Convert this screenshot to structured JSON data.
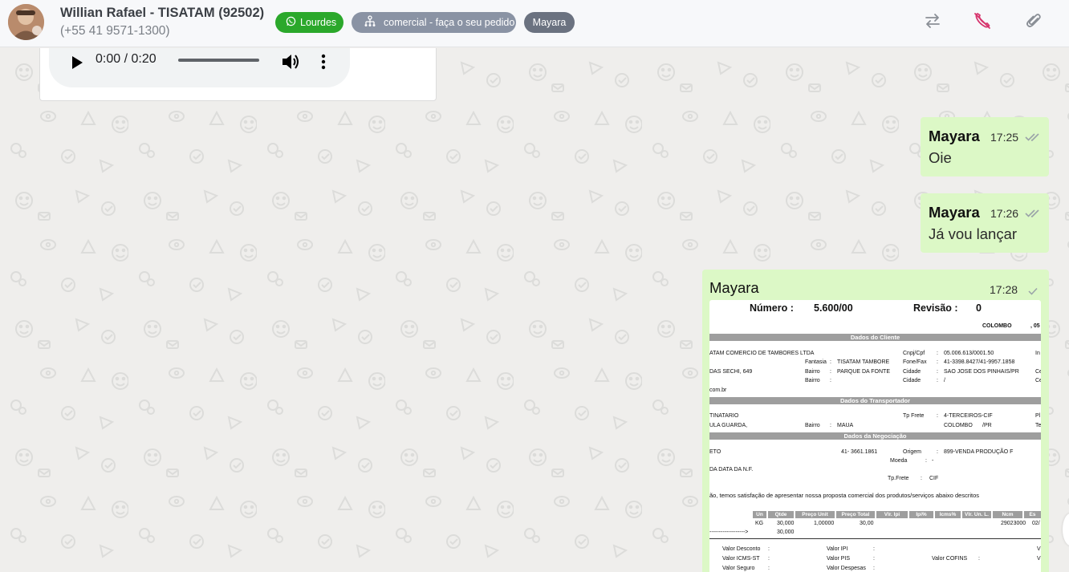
{
  "header": {
    "contact_name": "Willian Rafael - TISATAM (92502)",
    "contact_phone": "(+55 41 9571-1300)",
    "queue_tag": "Lourdes",
    "flow_tag": "comercial - faça o seu pedido",
    "user_tag": "Mayara",
    "colors": {
      "queue": "#2ba82b",
      "flow": "#8a93a4",
      "user": "#6b7280",
      "end_call": "#d6336c"
    },
    "icons": [
      "whatsapp-icon",
      "flow-icon",
      "transfer-icon",
      "end-call-icon",
      "attach-icon"
    ]
  },
  "audio": {
    "time": "0:00 / 0:20",
    "progress": 0
  },
  "messages": [
    {
      "sender": "Mayara",
      "time": "17:25",
      "text": "Oie",
      "status": "read"
    },
    {
      "sender": "Mayara",
      "time": "17:26",
      "text": "Já vou lançar",
      "status": "read"
    },
    {
      "sender": "Mayara",
      "time": "17:28",
      "type": "document-image",
      "status": "sent"
    }
  ],
  "document": {
    "numero_label": "Número :",
    "numero_value": "5.600/00",
    "revisao_label": "Revisão :",
    "revisao_value": "0",
    "city_header": "COLOMBO",
    "city_header_suffix": ", 05",
    "section_cliente": "Dados do Cliente",
    "section_transportador": "Dados do Transportador",
    "section_negociacao": "Dados da Negociação",
    "cliente": {
      "razao": "ATAM COMERCIO DE TAMBORES LTDA",
      "cnpj_label": "Cnpj/Cpf",
      "cnpj_value": "05.006.613/0001.50",
      "cnpj_extra": "In",
      "fantasia_label": "Fantasia",
      "fantasia_value": "TISATAM TAMBORE",
      "fone_label": "Fone/Fax",
      "fone_value": "41-3398.8427/41-9957.1858",
      "endereco": "DAS SECHI, 649",
      "bairro_label": "Bairro",
      "bairro_value": "PARQUE DA FONTE",
      "cidade_label": "Cidade",
      "cidade_value": "SAO JOSE DOS PINHAIS/PR",
      "cidade_extra": "Ce",
      "bairro2_label": "Bairro",
      "cidade2_label": "Cidade",
      "cidade2_value": "/",
      "cidade2_extra": "Ce",
      "email_suffix": "com.br"
    },
    "transportador": {
      "nome": "TINATARIO",
      "tp_frete_label": "Tp Frete",
      "tp_frete_value": "4-TERCEIROS-CIF",
      "extra1": "Pl",
      "endereco": "ULA GUARDA,",
      "bairro_label": "Bairro",
      "bairro_value": "MAUA",
      "cidade_value": "COLOMBO",
      "uf_value": "/PR",
      "extra2": "Te"
    },
    "negociacao": {
      "linha1_a": "ETO",
      "telefone": "41- 3661.1861",
      "origem_label": "Origem",
      "origem_value": "899-VENDA PRODUÇÃO F",
      "moeda_label": "Moeda",
      "moeda_value": "-",
      "data_nf": "DA DATA DA N.F.",
      "tp_frete_label": "Tp.Frete",
      "tp_frete_value": "CIF",
      "texto": "ão, temos satisfação de apresentar nossa proposta comercial dos produtos/serviços abaixo descritos"
    },
    "table_headers": [
      "Un",
      "Qtde",
      "Preço Unit",
      "Preço Total",
      "Vlr. Ipi",
      "Ipi%",
      "Icms%",
      "Vlr. Un. L.",
      "Ncm",
      "Es"
    ],
    "table_row": {
      "un": "KG",
      "qtde": "30,000",
      "preco_unit": "1,00000",
      "preco_total": "30,00",
      "ncm": "29023000",
      "extra": "02/"
    },
    "total_arrow": "------------------->",
    "total_qtde": "30,000",
    "totals": {
      "desconto": "Valor Desconto",
      "icms_st": "Valor ICMS-ST",
      "seguro": "Valor Seguro",
      "ipi": "Valor IPI",
      "pis": "Valor PIS",
      "despesas": "Valor Despesas",
      "cofins": "Valor COFINS",
      "colon": ":",
      "v": "V"
    }
  }
}
